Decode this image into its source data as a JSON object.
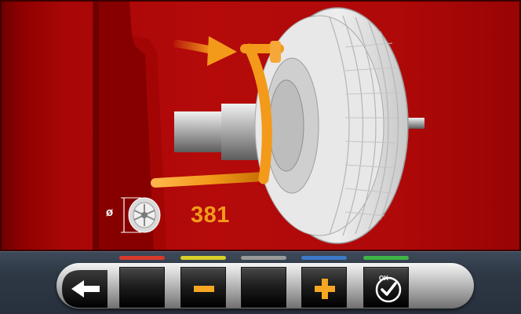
{
  "measurement": {
    "diameter_symbol": "ø",
    "diameter_value": "381"
  },
  "toolbar": {
    "buttons": [
      {
        "id": "back",
        "icon": "back-arrow-icon",
        "color_strip": null
      },
      {
        "id": "f1",
        "icon": "none",
        "color_strip": "#d83a2c"
      },
      {
        "id": "f2",
        "icon": "minus-icon",
        "color_strip": "#d9d02a"
      },
      {
        "id": "f3",
        "icon": "none",
        "color_strip": "#9a9a9a"
      },
      {
        "id": "f4",
        "icon": "plus-icon",
        "color_strip": "#3c79c9"
      },
      {
        "id": "f5",
        "icon": "ok-check-icon",
        "color_strip": "#3fb548",
        "label": "OK"
      }
    ]
  },
  "colors": {
    "background_red": "#b40a0a",
    "accent_orange": "#f39a1a",
    "toolbar_bg": "#2e3845"
  }
}
